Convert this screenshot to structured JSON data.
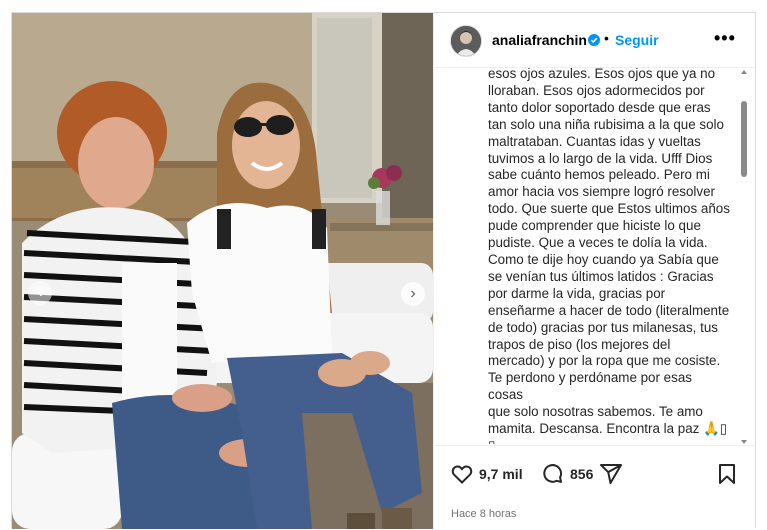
{
  "post": {
    "username": "analiafranchin",
    "separator": "•",
    "follow_label": "Seguir",
    "more_label": "•••",
    "caption": "esos ojos azules. Esos ojos que ya no\nlloraban. Esos ojos adormecidos por\ntanto dolor soportado desde que eras\ntan solo una niña rubisima a la que solo\nmaltrataban. Cuantas idas y vueltas\ntuvimos a lo largo de la vida. Ufff Dios\nsabe cuánto hemos peleado. Pero mi\namor hacia vos siempre logró resolver\ntodo. Que suerte que Estos ultimos años\npude comprender que hiciste lo que\npudiste. Que a veces te dolía la vida.\nComo te dije hoy cuando ya Sabía que\nse venían tus últimos latidos : Gracias\npor darme la vida, gracias por\nenseñarme a hacer de todo (literalmente\nde todo) gracias por tus milanesas, tus\ntrapos de piso (los mejores del\nmercado) y por la ropa que me cosiste.\nTe perdono y perdóname por esas cosas\nque solo nosotras sabemos. Te amo\nmamita. Descansa. Encontra la paz 🙏▯\n▯",
    "likes": "9,7 mil",
    "comments": "856",
    "timestamp": "Hace 8 horas"
  },
  "icons": {
    "verified": "verified-badge-icon",
    "like": "heart-icon",
    "comment": "comment-icon",
    "share": "share-icon",
    "save": "bookmark-icon",
    "prev": "chevron-left-icon",
    "next": "chevron-right-icon"
  },
  "colors": {
    "accent": "#0095f6",
    "text": "#262626",
    "muted": "#737373"
  }
}
